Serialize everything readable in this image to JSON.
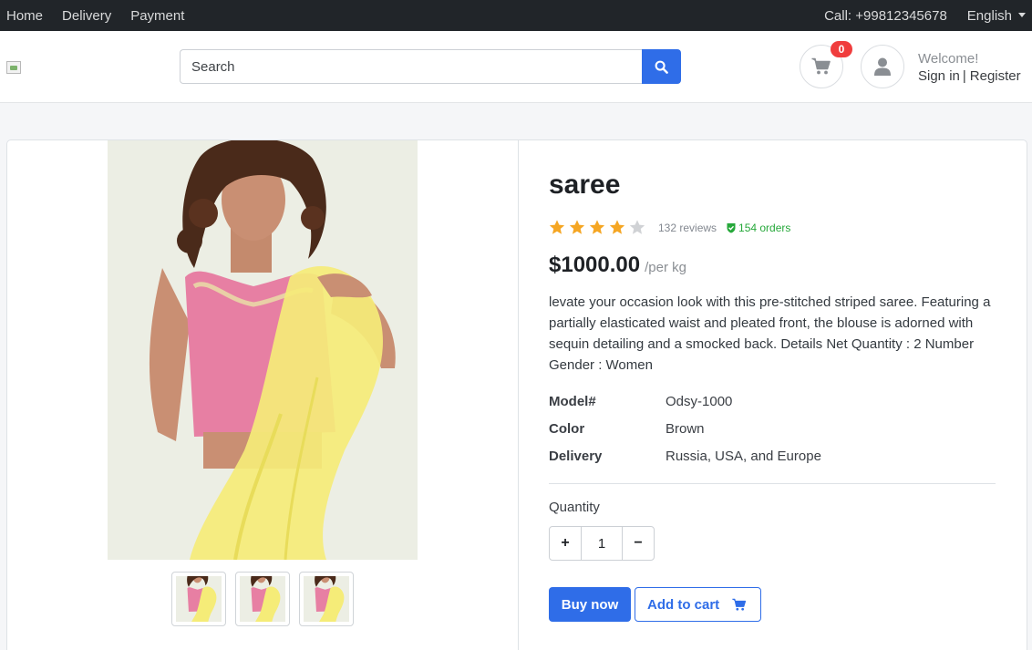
{
  "topbar": {
    "nav": [
      "Home",
      "Delivery",
      "Payment"
    ],
    "phone": "Call: +99812345678",
    "language": "English"
  },
  "header": {
    "search_placeholder": "Search",
    "cart_count": "0",
    "welcome": "Welcome!",
    "sign_in": "Sign in",
    "separator": "|",
    "register": "Register"
  },
  "product": {
    "title": "saree",
    "rating": 4,
    "rating_max": 5,
    "reviews": "132 reviews",
    "orders": "154 orders",
    "price": "$1000.00",
    "unit": "/per kg",
    "description": "levate your occasion look with this pre-stitched striped saree. Featuring a partially elasticated waist and pleated front, the blouse is adorned with sequin detailing and a smocked back. Details Net Quantity : 2 Number Gender : Women",
    "specs": [
      {
        "key": "Model#",
        "value": "Odsy-1000"
      },
      {
        "key": "Color",
        "value": "Brown"
      },
      {
        "key": "Delivery",
        "value": "Russia, USA, and Europe"
      }
    ],
    "quantity_label": "Quantity",
    "quantity": "1",
    "plus": "+",
    "minus": "−",
    "buy_now": "Buy now",
    "add_to_cart": "Add to cart",
    "thumbnails": 3
  },
  "colors": {
    "primary": "#2f6de8",
    "star": "#f5a623",
    "badge": "#f03d3d",
    "orders": "#26a83a"
  }
}
